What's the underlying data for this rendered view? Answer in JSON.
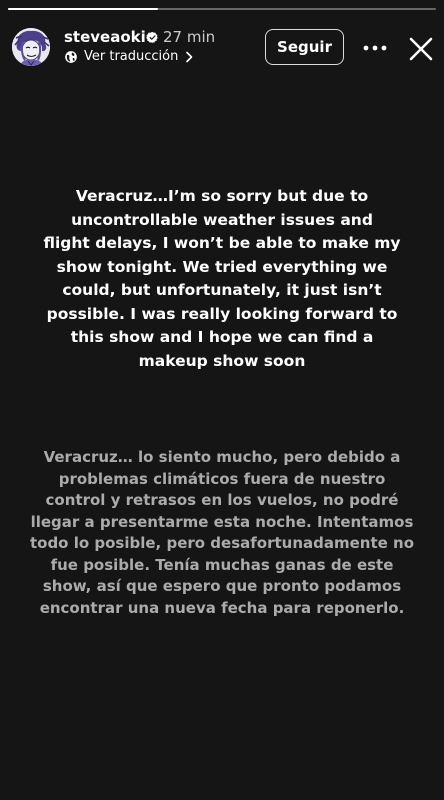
{
  "header": {
    "username": "steveaoki",
    "timestamp": "27 min",
    "translate_label": "Ver traducción",
    "follow_label": "Seguir",
    "verified": true,
    "more_icon": "more-horizontal-icon",
    "close_icon": "close-icon",
    "globe_icon": "globe-icon"
  },
  "story": {
    "progress": 0.35,
    "english_text": "Veracruz…I’m so sorry but due to\nuncontrollable weather issues and\nflight delays, I won’t be able to make my\nshow tonight.  We tried everything we\ncould, but unfortunately, it just isn’t\npossible.  I was really looking forward to\nthis show and I hope we can find a\nmakeup show soon",
    "spanish_text": "Veracruz… lo siento mucho, pero debido a\nproblemas climáticos fuera de nuestro\ncontrol y retrasos en los vuelos, no podré\nllegar a presentarme esta noche. Intentamos\ntodo lo posible, pero desafortunadamente no\nfue posible. Tenía muchas ganas de este\nshow, así que espero que pronto podamos\nencontrar una nueva fecha para reponerlo."
  },
  "colors": {
    "background": "#151515",
    "primary_text": "#ffffff",
    "translation_text": "#ababab",
    "verified_badge": "#ffffff"
  }
}
